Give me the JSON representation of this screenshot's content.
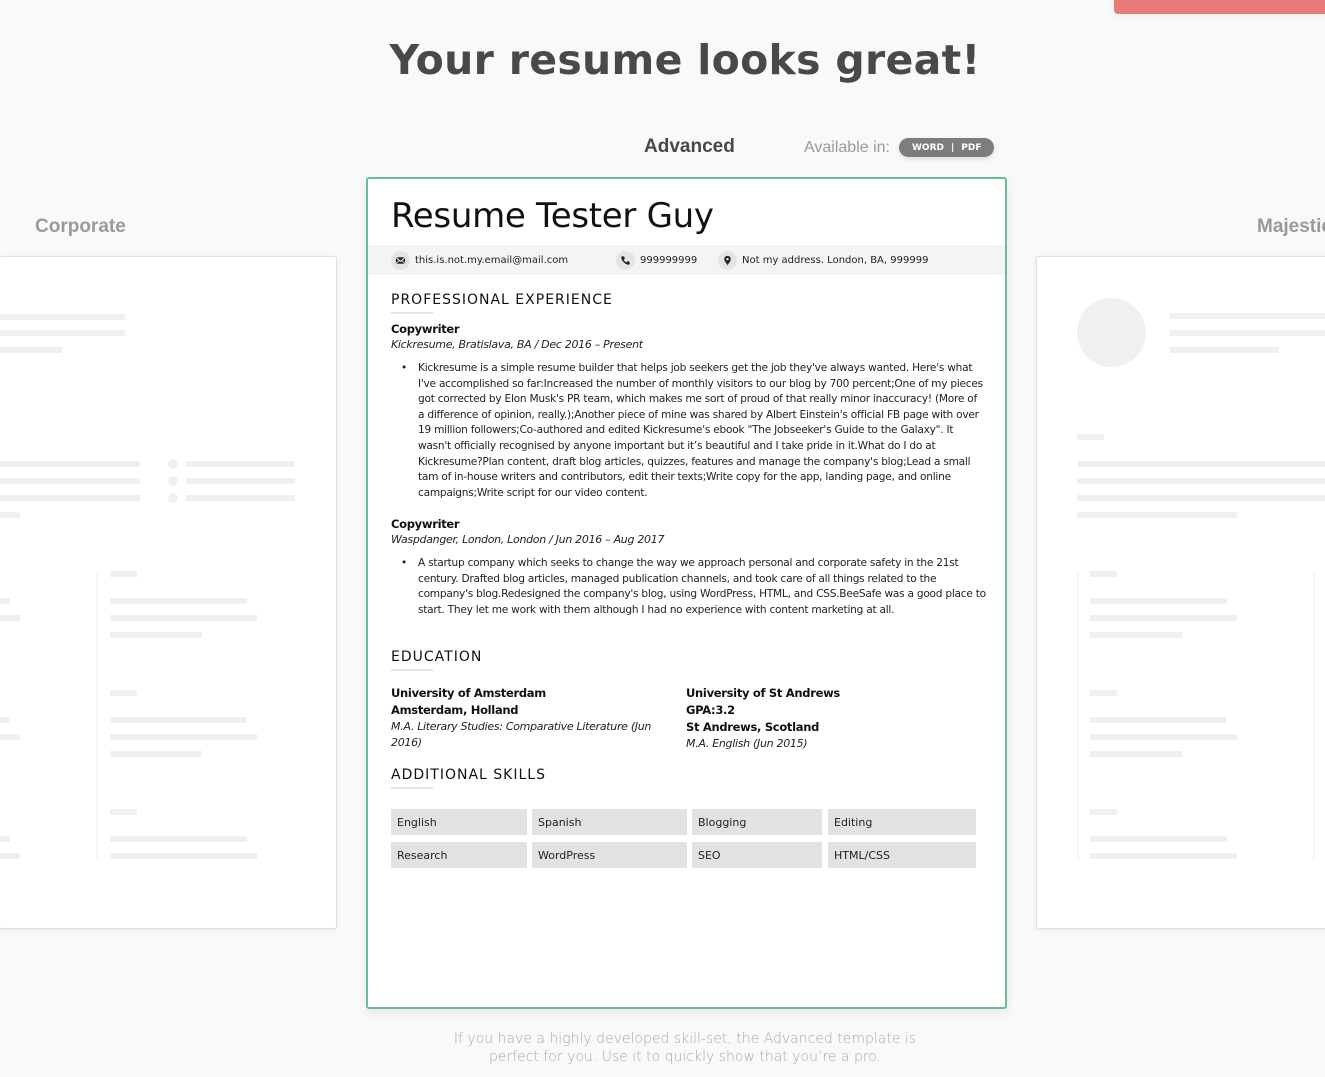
{
  "page": {
    "title": "Your resume looks great!",
    "description_line1": "If you have a highly developed skill-set, the Advanced template is",
    "description_line2": "perfect for you. Use it to quickly show that you’re a pro.",
    "accent_color": "#6bbd93",
    "cta_color": "#e77b78"
  },
  "templates": {
    "left": "Corporate",
    "active": "Advanced",
    "right": "Majestic"
  },
  "availability": {
    "label": "Available in:",
    "formats": [
      "WORD",
      "PDF"
    ],
    "separator": "|"
  },
  "resume": {
    "name": "Resume Tester Guy",
    "contact": {
      "email": "this.is.not.my.email@mail.com",
      "phone": "999999999",
      "address": "Not my address. London, BA, 999999"
    },
    "sections": {
      "experience": "PROFESSIONAL EXPERIENCE",
      "education": "EDUCATION",
      "skills": "ADDITIONAL SKILLS"
    },
    "jobs": [
      {
        "title": "Copywriter",
        "subtitle": "Kickresume, Bratislava, BA / Dec 2016 – Present",
        "bullet": "Kickresume is a simple resume builder that helps job seekers get the job they've always wanted. Here's what I've accomplished so far:Increased the number of monthly visitors to our blog by 700 percent;One of my pieces got corrected by Elon Musk's PR team, which makes me sort of proud of that really minor inaccuracy! (More of a difference of opinion, really.);Another piece of mine was shared by Albert Einstein's official FB page with over 19 million followers;Co-authored and edited Kickresume's ebook \"The Jobseeker's Guide to the Galaxy\". It wasn't officially recognised by anyone important but it’s beautiful and I take pride in it.What do I do at Kickresume?Plan content, draft blog articles, quizzes, features and manage the company's blog;Lead a small tam of in-house writers and contributors, edit their texts;Write copy for the app, landing page, and online campaigns;Write script for our video content."
      },
      {
        "title": "Copywriter",
        "subtitle": "Waspdanger, London, London / Jun 2016 – Aug 2017",
        "bullet": "A startup company which seeks to change the way we approach personal and corporate safety in the 21st century. Drafted blog articles, managed publication channels, and took care of all things related to the company's blog.Redesigned the company's blog, using WordPress, HTML, and CSS.BeeSafe was a good place to start. They let me work with them although I had no experience with content marketing at all."
      }
    ],
    "education": [
      {
        "school": "University of Amsterdam",
        "location": "Amsterdam, Holland",
        "degree": "M.A. Literary Studies: Comparative Literature (Jun 2016)"
      },
      {
        "school": "University of St Andrews",
        "gpa": "GPA:3.2",
        "location": "St Andrews, Scotland",
        "degree": "M.A. English (Jun 2015)"
      }
    ],
    "skills": [
      "English",
      "Spanish",
      "Blogging",
      "Editing",
      "Research",
      "WordPress",
      "SEO",
      "HTML/CSS"
    ]
  }
}
